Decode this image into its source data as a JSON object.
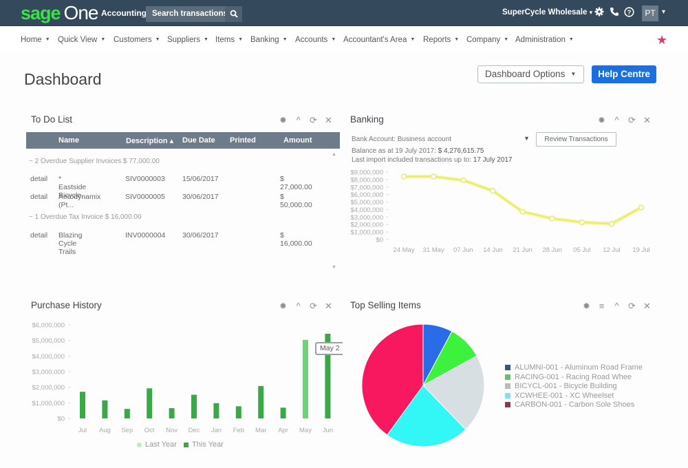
{
  "topbar": {
    "logo_sage": "sage",
    "logo_one": "One",
    "logo_sub": "Accounting",
    "search_placeholder": "Search transactions",
    "search_icon": "search-icon",
    "company": "SuperCycle Wholesale",
    "company_caret": "▾",
    "settings_icon": "⚙",
    "phone_icon": "✆",
    "help_icon": "?",
    "avatar": "PT",
    "avatar_caret": "▾"
  },
  "menu": {
    "items": [
      {
        "label": "Home"
      },
      {
        "label": "Quick View"
      },
      {
        "label": "Customers"
      },
      {
        "label": "Suppliers"
      },
      {
        "label": "Items"
      },
      {
        "label": "Banking"
      },
      {
        "label": "Accounts"
      },
      {
        "label": "Accountant's Area"
      },
      {
        "label": "Reports"
      },
      {
        "label": "Company"
      },
      {
        "label": "Administration"
      }
    ],
    "caret": "▼",
    "star": "★"
  },
  "page": {
    "title": "Dashboard",
    "dashboard_options": "Dashboard Options",
    "help_centre": "Help Centre"
  },
  "widget_icons": {
    "gear": "✹",
    "collapse": "^",
    "refresh": "⟳",
    "close": "✕",
    "menu": "≡"
  },
  "todo": {
    "title": "To Do List",
    "columns": [
      "Name",
      "Description ▴",
      "Due Date",
      "Printed",
      "Amount"
    ],
    "groups": [
      {
        "label": "−  2 Overdue Supplier Invoices $ 77,000.00",
        "rows": [
          {
            "link": "detail",
            "name": "* Eastside Bicycle...",
            "description": "SIV0000003",
            "due": "15/06/2017",
            "printed": "",
            "amount": "$ 27,000.00"
          },
          {
            "link": "detail",
            "name": "Aerodynamix (Pt...",
            "description": "SIV0000005",
            "due": "30/06/2017",
            "printed": "",
            "amount": "$ 50,000.00"
          }
        ]
      },
      {
        "label": "−  1 Overdue Tax Invoice $ 16,000.00",
        "rows": [
          {
            "link": "detail",
            "name": "Blazing Cycle Trails",
            "description": "INV0000004",
            "due": "30/06/2017",
            "printed": "",
            "amount": "$ 16,000.00"
          }
        ]
      }
    ]
  },
  "banking": {
    "title": "Banking",
    "account_label": "Bank Account:  Business account",
    "review_button": "Review Transactions",
    "balance_prefix": "Balance as at 19 July 2017: ",
    "balance_value": "$ 4,276,615.75",
    "import_prefix": "Last import included transactions up to: ",
    "import_value": "17 July 2017"
  },
  "purchase_history": {
    "title": "Purchase History",
    "tooltip": "May 2",
    "legend": [
      "Last Year",
      "This Year"
    ]
  },
  "top_selling": {
    "title": "Top Selling Items"
  },
  "chart_data": [
    {
      "type": "line",
      "title": "Banking",
      "x": [
        "24 May",
        "31 May",
        "07 Jun",
        "14 Jun",
        "21 Jun",
        "28 Jun",
        "05 Jul",
        "12 Jul",
        "19 Jul"
      ],
      "series": [
        {
          "name": "Balance",
          "values": [
            8400000,
            8400000,
            7900000,
            6500000,
            3700000,
            2800000,
            2300000,
            2100000,
            4276616
          ],
          "color": "#e8ec6a"
        }
      ],
      "ylim": [
        0,
        9000000
      ],
      "yticks": [
        "$0",
        "$1,000,000",
        "$2,000,000",
        "$3,000,000",
        "$4,000,000",
        "$5,000,000",
        "$6,000,000",
        "$7,000,000",
        "$8,000,000",
        "$9,000,000"
      ],
      "grid": false
    },
    {
      "type": "bar",
      "title": "Purchase History",
      "categories": [
        "Jul",
        "Aug",
        "Sep",
        "Oct",
        "Nov",
        "Dec",
        "Jan",
        "Feb",
        "Mar",
        "Apr",
        "May",
        "Jun"
      ],
      "series": [
        {
          "name": "Last Year",
          "color": "#6fd17a",
          "values": [
            null,
            null,
            null,
            null,
            null,
            null,
            null,
            null,
            null,
            null,
            5040000,
            null
          ]
        },
        {
          "name": "This Year",
          "color": "#3aa847",
          "values": [
            1710000,
            1160000,
            610000,
            1930000,
            660000,
            1520000,
            980000,
            780000,
            2080000,
            690000,
            null,
            5430000
          ]
        }
      ],
      "ylim": [
        0,
        6000000
      ],
      "yticks": [
        "$0",
        "$1,000,000",
        "$2,000,000",
        "$3,000,000",
        "$4,000,000",
        "$5,000,000",
        "$6,000,000"
      ],
      "legend": "bottom",
      "grid": false
    },
    {
      "type": "pie",
      "title": "Top Selling Items",
      "slices": [
        {
          "label": "ALUMNI-001 - Aluminum Road Frame",
          "value": 7.8,
          "color": "#2a6ce8"
        },
        {
          "label": "RACING-001 - Racing Road Whee",
          "value": 9.2,
          "color": "#3df23d"
        },
        {
          "label": "BICYCL-001 - Bicycle Building",
          "value": 20.8,
          "color": "#d7dfe3"
        },
        {
          "label": "XCWHEE-001 - XC Wheelset",
          "value": 22.2,
          "color": "#33f7f7"
        },
        {
          "label": "CARBON-001 - Carbon Sole Shoes",
          "value": 40.0,
          "color": "#f7185f"
        }
      ],
      "legend_swatches": [
        "#34578a",
        "#6bbf6b",
        "#b9bcbe",
        "#7fe3e8",
        "#8a3a52"
      ],
      "legend": "right"
    }
  ]
}
